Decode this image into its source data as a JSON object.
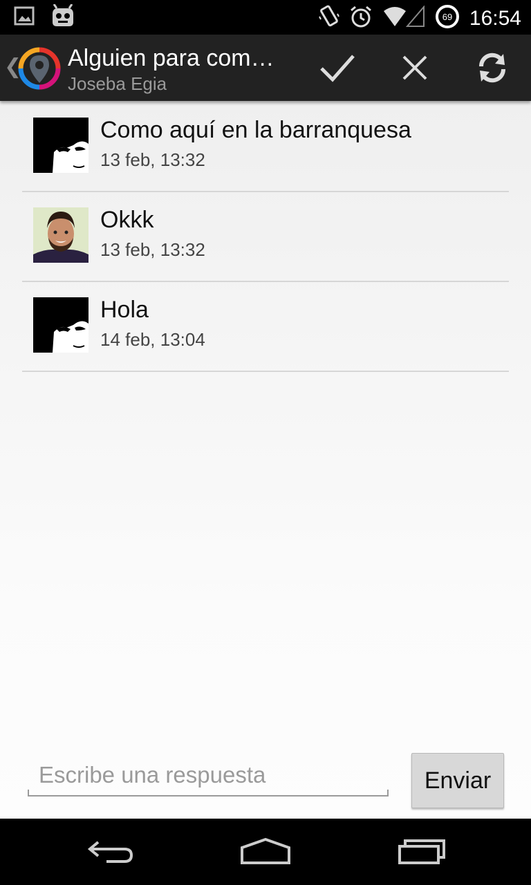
{
  "status_bar": {
    "time": "16:54",
    "battery": "69",
    "left_icons": [
      "gallery-icon",
      "android-bot-icon"
    ],
    "right_icons": [
      "vibrate-icon",
      "alarm-icon",
      "wifi-icon",
      "battery-icon"
    ]
  },
  "action_bar": {
    "title": "Alguien para com…",
    "subtitle": "Joseba Egia",
    "actions": [
      "check-icon",
      "close-icon",
      "refresh-icon"
    ]
  },
  "messages": [
    {
      "text": "Como aquí en la barranquesa",
      "time": "13 feb, 13:32",
      "avatar": "avatar-bw"
    },
    {
      "text": "Okkk",
      "time": "13 feb, 13:32",
      "avatar": "avatar-photo"
    },
    {
      "text": "Hola",
      "time": "14 feb, 13:04",
      "avatar": "avatar-bw"
    }
  ],
  "reply": {
    "placeholder": "Escribe una respuesta",
    "send_label": "Enviar"
  },
  "nav_bar": {
    "icons": [
      "back-icon",
      "home-icon",
      "recents-icon"
    ]
  }
}
